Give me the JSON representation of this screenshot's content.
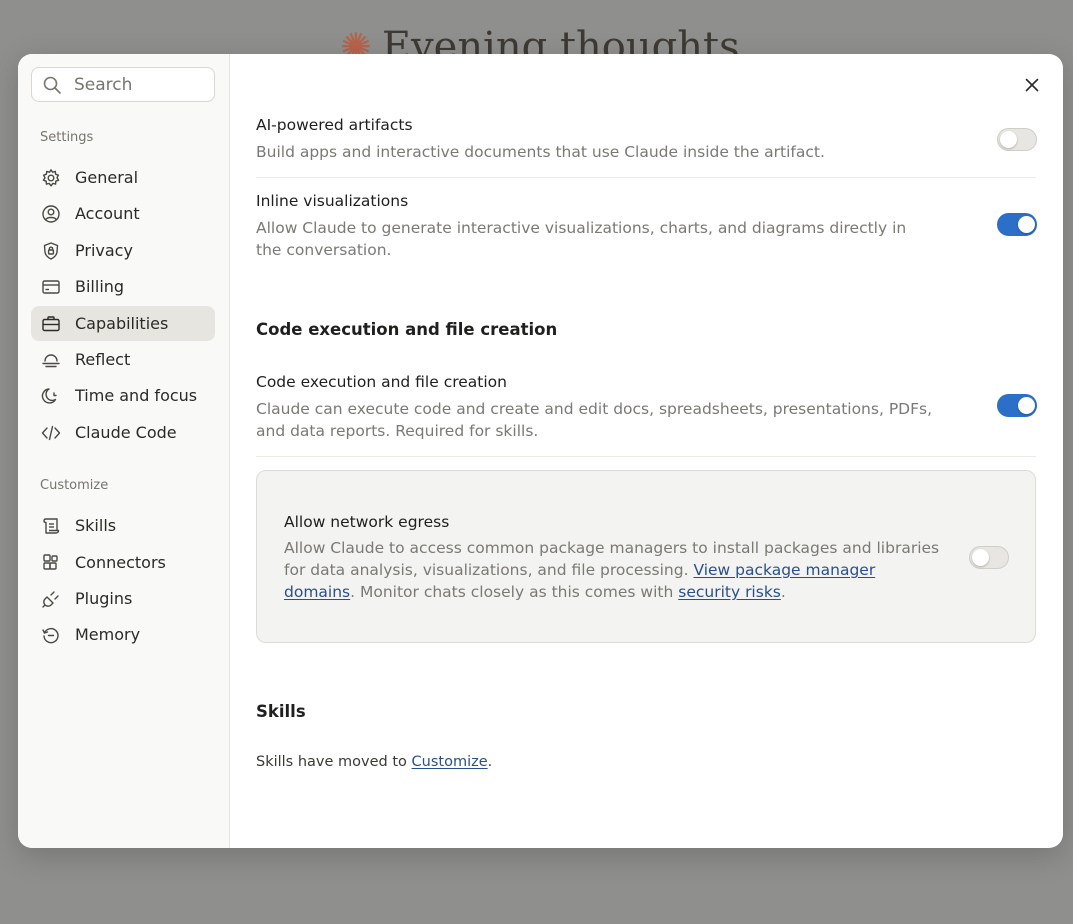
{
  "backdrop": {
    "title": "Evening thoughts"
  },
  "search": {
    "placeholder": "Search",
    "value": ""
  },
  "sidebar": {
    "settings_label": "Settings",
    "settings_items": [
      {
        "label": "General",
        "icon": "gear-icon"
      },
      {
        "label": "Account",
        "icon": "user-circle-icon"
      },
      {
        "label": "Privacy",
        "icon": "shield-icon"
      },
      {
        "label": "Billing",
        "icon": "credit-card-icon"
      },
      {
        "label": "Capabilities",
        "icon": "briefcase-icon",
        "active": true
      },
      {
        "label": "Reflect",
        "icon": "reflect-icon"
      },
      {
        "label": "Time and focus",
        "icon": "moon-icon"
      },
      {
        "label": "Claude Code",
        "icon": "code-icon"
      }
    ],
    "customize_label": "Customize",
    "customize_items": [
      {
        "label": "Skills",
        "icon": "scroll-icon"
      },
      {
        "label": "Connectors",
        "icon": "connectors-icon"
      },
      {
        "label": "Plugins",
        "icon": "plug-icon"
      },
      {
        "label": "Memory",
        "icon": "history-icon"
      }
    ]
  },
  "main": {
    "close_icon": "close-icon",
    "artifacts": {
      "title": "AI-powered artifacts",
      "description": "Build apps and interactive documents that use Claude inside the artifact.",
      "enabled": false
    },
    "inline_viz": {
      "title": "Inline visualizations",
      "description": "Allow Claude to generate interactive visualizations, charts, and diagrams directly in the conversation.",
      "enabled": true
    },
    "code_section_heading": "Code execution and file creation",
    "code_exec": {
      "title": "Code execution and file creation",
      "description": "Claude can execute code and create and edit docs, spreadsheets, presentations, PDFs, and data reports. Required for skills.",
      "enabled": true
    },
    "egress": {
      "title": "Allow network egress",
      "desc_part1": "Allow Claude to access common package managers to install packages and libraries for data analysis, visualizations, and file processing. ",
      "link1": "View package manager domains",
      "desc_part2": ". Monitor chats closely as this comes with ",
      "link2": "security risks",
      "desc_part3": ".",
      "enabled": false
    },
    "skills_heading": "Skills",
    "skills_text_prefix": "Skills have moved to ",
    "skills_link": "Customize",
    "skills_text_suffix": "."
  },
  "colors": {
    "toggle_on": "#2c6fc9",
    "link": "#2a4f8a",
    "active_nav_bg": "#e6e5e0",
    "accent_asterisk": "#b9624a"
  }
}
